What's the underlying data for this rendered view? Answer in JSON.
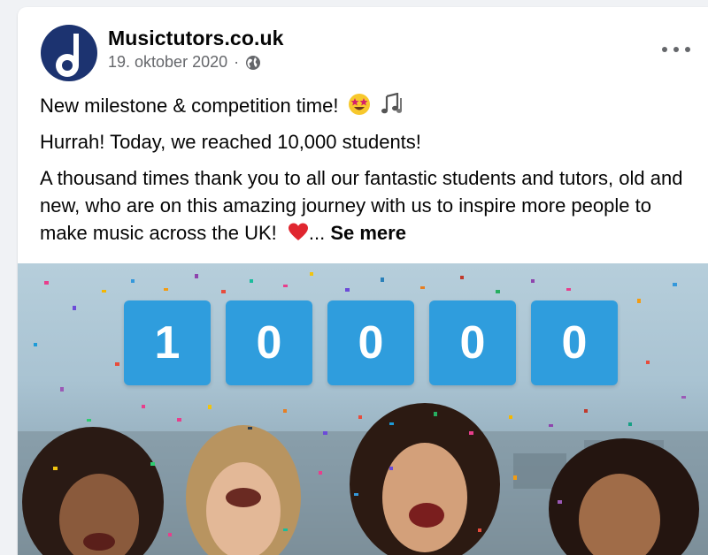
{
  "post": {
    "author": "Musictutors.co.uk",
    "date": "19. oktober 2020",
    "separator": "·",
    "privacy_icon": "globe-icon",
    "more_icon": "more-options-icon",
    "line1": "New milestone & competition time!",
    "line1_emojis": [
      "star-struck-emoji",
      "musical-notes-emoji"
    ],
    "line2": "Hurrah! Today, we reached 10,000 students!",
    "line3": "A thousand times thank you to all our fantastic students and tutors, old and new, who are on this amazing journey with us to inspire more people to make music across the UK!",
    "line3_emoji": "red-heart-emoji",
    "ellipsis": "...",
    "see_more": "Se mere"
  },
  "image": {
    "digits": [
      "1",
      "0",
      "0",
      "0",
      "0"
    ],
    "digit_color": "#2f9ddd"
  },
  "colors": {
    "background": "#f0f2f5",
    "avatar": "#1c3370",
    "text": "#050505",
    "muted": "#65676b"
  }
}
